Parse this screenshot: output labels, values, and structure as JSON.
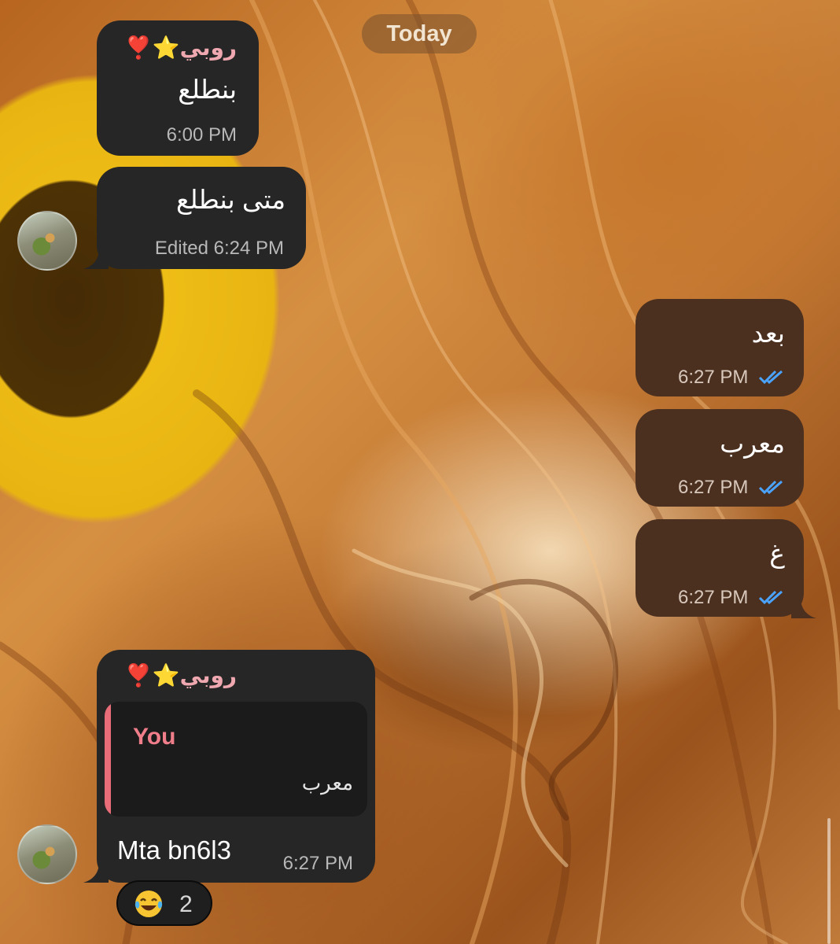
{
  "date_separator": "Today",
  "messages": [
    {
      "sender": "روبي⭐️❣️",
      "text": "بنطلع",
      "time": "6:00 PM"
    },
    {
      "text": "متى بنطلع",
      "time": "Edited 6:24 PM"
    },
    {
      "text": "بعد",
      "time": "6:27 PM"
    },
    {
      "text": "معرب",
      "time": "6:27 PM"
    },
    {
      "text": "غ",
      "time": "6:27 PM"
    },
    {
      "sender": "روبي⭐️❣️",
      "reply": {
        "name": "You",
        "text": "معرب"
      },
      "text": "Mta bn6l3",
      "time": "6:27 PM",
      "reaction": {
        "emoji": "😂",
        "count": "2"
      }
    }
  ],
  "colors": {
    "incoming": "#262626",
    "outgoing": "#4b3020",
    "reply_accent": "#e86d78",
    "check": "#4aa3ff"
  }
}
